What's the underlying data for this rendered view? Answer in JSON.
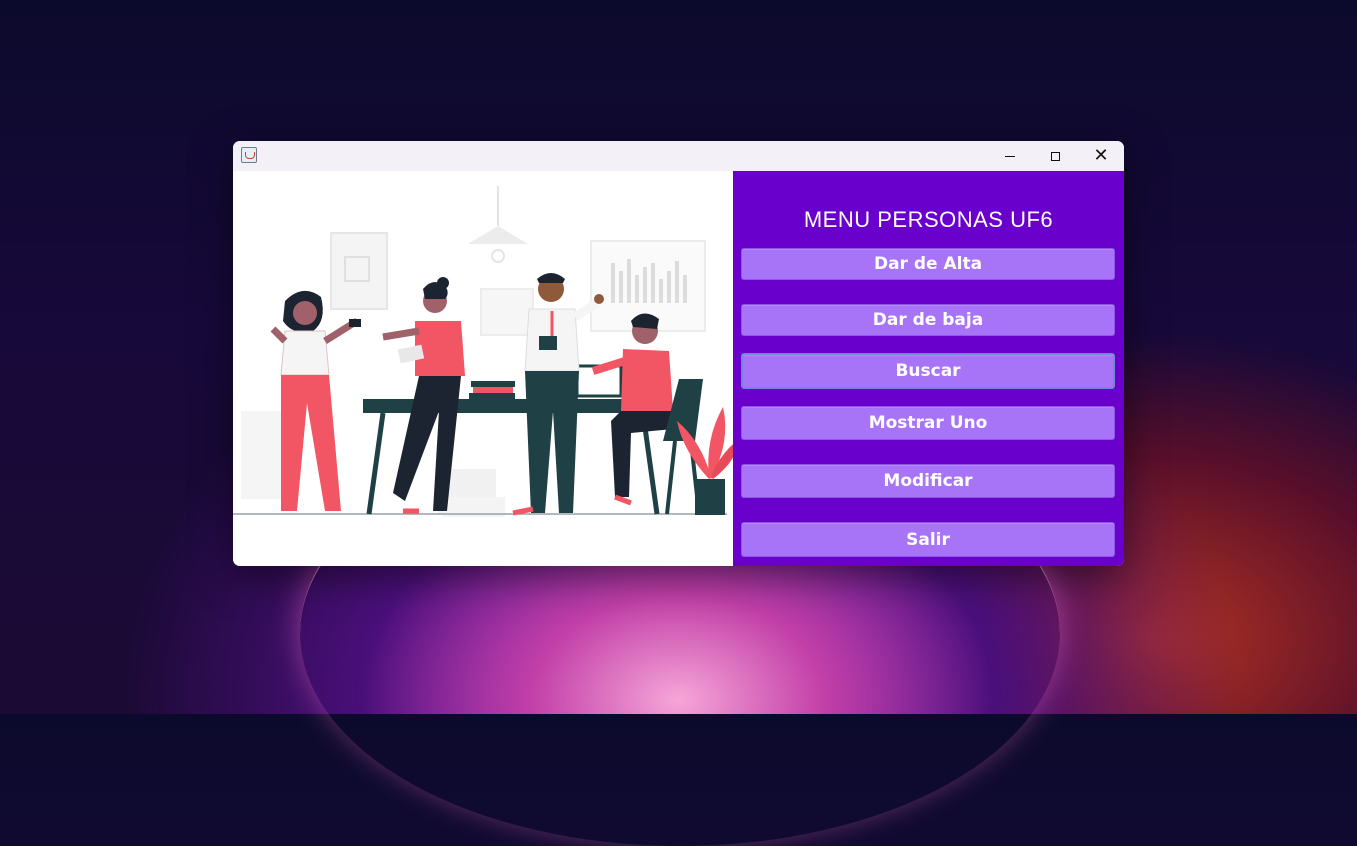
{
  "window": {
    "title": "",
    "controls": {
      "minimize": "minimize-icon",
      "maximize": "maximize-icon",
      "close": "close-icon"
    }
  },
  "menu": {
    "title": "MENU PERSONAS UF6",
    "buttons": [
      {
        "label": "Dar de Alta"
      },
      {
        "label": "Dar de baja"
      },
      {
        "label": "Buscar"
      },
      {
        "label": "Mostrar Uno"
      },
      {
        "label": "Modificar"
      },
      {
        "label": "Salir"
      }
    ]
  },
  "colors": {
    "menu_background": "#6a00cc",
    "button_background": "#a874f7",
    "illustration_accent": "#f25563",
    "illustration_dark": "#1f4045"
  }
}
